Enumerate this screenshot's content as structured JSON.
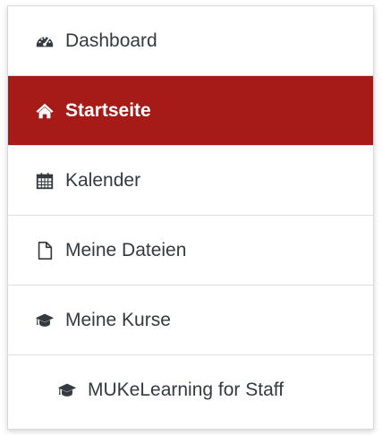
{
  "nav": {
    "items": [
      {
        "label": "Dashboard",
        "icon": "dashboard-gauge-icon",
        "active": false
      },
      {
        "label": "Startseite",
        "icon": "home-icon",
        "active": true
      },
      {
        "label": "Kalender",
        "icon": "calendar-icon",
        "active": false
      },
      {
        "label": "Meine Dateien",
        "icon": "file-icon",
        "active": false
      },
      {
        "label": "Meine Kurse",
        "icon": "graduation-cap-icon",
        "active": false
      },
      {
        "label": "MUKeLearning for Staff",
        "icon": "graduation-cap-icon",
        "active": false
      }
    ]
  },
  "colors": {
    "active_background": "#a61a18",
    "active_text": "#ffffff",
    "text": "#343a40",
    "border": "#dfdfdf"
  }
}
